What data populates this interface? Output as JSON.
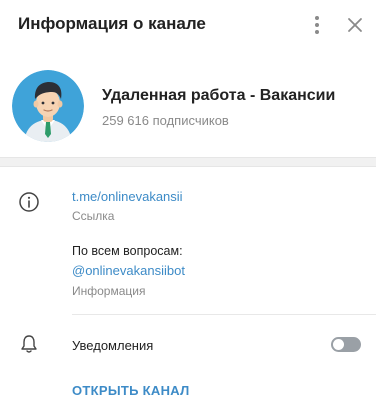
{
  "header": {
    "title": "Информация о канале",
    "menu_icon": "more-vertical-icon",
    "close_icon": "close-icon"
  },
  "channel": {
    "name": "Удаленная работа - Вакансии",
    "subscribers": "259 616 подписчиков",
    "avatar": "avatar-man-in-suit"
  },
  "info": {
    "icon": "info-icon",
    "link": "t.me/onlinevakansii",
    "link_label": "Ссылка",
    "description_line1": "По всем вопросам:",
    "description_mention": "@onlinevakansiibot",
    "description_label": "Информация"
  },
  "notifications": {
    "icon": "bell-icon",
    "label": "Уведомления",
    "enabled": false
  },
  "actions": {
    "open_channel": "ОТКРЫТЬ КАНАЛ"
  },
  "colors": {
    "accent": "#3d8bc7",
    "secondary_text": "#8a8a8a",
    "avatar_bg": "#3fa3d9",
    "toggle_off": "#9aa0a6"
  }
}
